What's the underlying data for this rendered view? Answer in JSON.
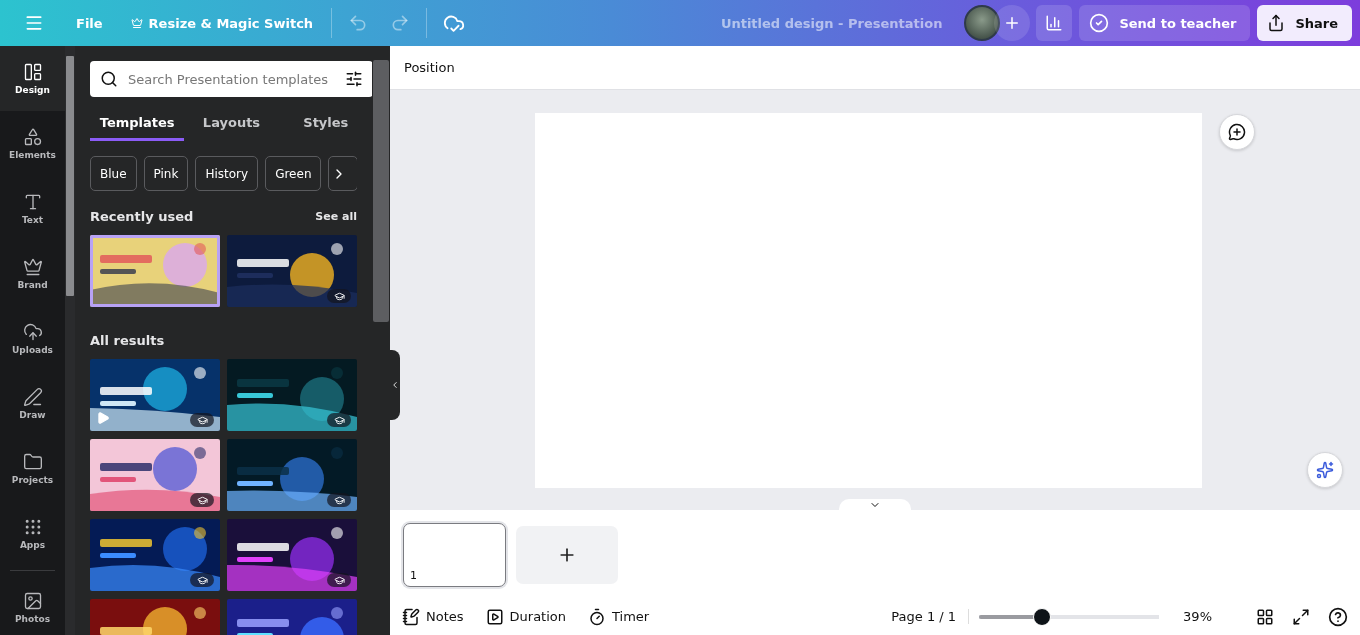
{
  "topbar": {
    "file": "File",
    "resize": "Resize & Magic Switch",
    "title": "Untitled design - Presentation",
    "send": "Send to teacher",
    "share": "Share"
  },
  "rail": [
    {
      "label": "Design",
      "selected": true
    },
    {
      "label": "Elements",
      "selected": false
    },
    {
      "label": "Text",
      "selected": false
    },
    {
      "label": "Brand",
      "selected": false
    },
    {
      "label": "Uploads",
      "selected": false
    },
    {
      "label": "Draw",
      "selected": false
    },
    {
      "label": "Projects",
      "selected": false
    },
    {
      "label": "Apps",
      "selected": false
    },
    {
      "label": "Photos",
      "selected": false
    }
  ],
  "panel": {
    "search": {
      "placeholder": "Search Presentation templates"
    },
    "tabs": [
      {
        "label": "Templates",
        "selected": true
      },
      {
        "label": "Layouts",
        "selected": false
      },
      {
        "label": "Styles",
        "selected": false
      }
    ],
    "chips": [
      "Blue",
      "Pink",
      "History",
      "Green"
    ],
    "recent": {
      "title": "Recently used",
      "see_all": "See all",
      "items": [
        {
          "kind": "picture",
          "selected": true,
          "badge": false
        },
        {
          "kind": "picture",
          "selected": false,
          "badge": true
        }
      ]
    },
    "results": {
      "title": "All results",
      "items": [
        {
          "kind": "picture",
          "badge": true,
          "video": true
        },
        {
          "kind": "picture",
          "badge": true,
          "video": false
        },
        {
          "kind": "picture",
          "badge": true,
          "video": false
        },
        {
          "kind": "picture",
          "badge": true,
          "video": false
        },
        {
          "kind": "picture",
          "badge": true,
          "video": false
        },
        {
          "kind": "picture",
          "badge": true,
          "video": false
        },
        {
          "kind": "picture",
          "badge": false,
          "video": false
        },
        {
          "kind": "picture",
          "badge": false,
          "video": false
        }
      ]
    }
  },
  "editor": {
    "toolbar": "Position",
    "pages": [
      {
        "number": "1",
        "selected": true
      }
    ]
  },
  "footer": {
    "notes": "Notes",
    "duration": "Duration",
    "timer": "Timer",
    "page": "Page 1 / 1",
    "zoom": {
      "level": 0.35
    },
    "zoom_reading": "39%"
  }
}
